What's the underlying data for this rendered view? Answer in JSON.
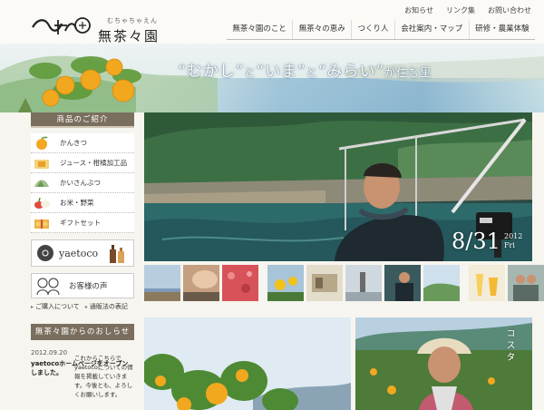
{
  "brand": {
    "ruby": "むちゃちゃえん",
    "name": "無茶々園"
  },
  "util_links": [
    "お知らせ",
    "リンク集",
    "お問い合わせ"
  ],
  "global_nav": [
    "無茶々園のこと",
    "無茶々の恵み",
    "つくり人",
    "会社案内・マップ",
    "研修・農業体験"
  ],
  "hero": {
    "tagline_parts": [
      "“むかし”",
      "と",
      "“いま”",
      "と",
      "“みらい”",
      "が住む里"
    ]
  },
  "sidebar": {
    "products_heading": "商品のご紹介",
    "products": [
      {
        "label": "かんきつ",
        "icon": "citrus-icon"
      },
      {
        "label": "ジュース・柑橘加工品",
        "icon": "juice-icon"
      },
      {
        "label": "かいさんぶつ",
        "icon": "seafood-icon"
      },
      {
        "label": "お米・野菜",
        "icon": "vegetables-icon"
      },
      {
        "label": "ギフトセット",
        "icon": "gift-icon"
      }
    ],
    "yaetoco_label": "yaetoco",
    "voice_label": "お客様の声",
    "links": [
      "ご購入について",
      "通販法の表記"
    ],
    "news_heading": "無茶々園からのおしらせ",
    "news": [
      {
        "date": "2012.09.20",
        "title": "yaetocoホームページをオープンしました。"
      }
    ]
  },
  "main_photo": {
    "date": "8/31",
    "year": "2012",
    "weekday": "Fri"
  },
  "intro_text": "これからこちらでyaetocoについての情報を掲載していきます。今後とも、よろしくお願いします。",
  "card_right_text": "コスタ",
  "colors": {
    "heading_bg": "#7a6f5e",
    "nav_border": "#bbbbbb",
    "accent_orange": "#f0a020"
  }
}
